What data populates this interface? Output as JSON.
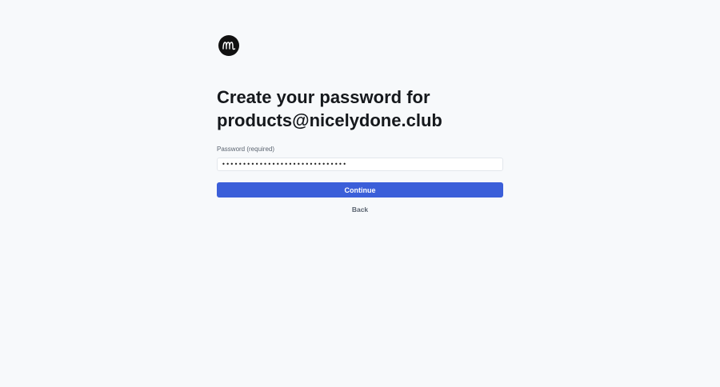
{
  "logo": {
    "icon": "m-monogram-icon",
    "background_color": "#111111"
  },
  "heading": {
    "line1": "Create your password for",
    "line2": "products@nicelydone.club"
  },
  "password_field": {
    "label": "Password (required)",
    "value": "••••••••••••••••••••••••••••••"
  },
  "buttons": {
    "continue_label": "Continue",
    "continue_color": "#3b5fd9",
    "back_label": "Back"
  }
}
